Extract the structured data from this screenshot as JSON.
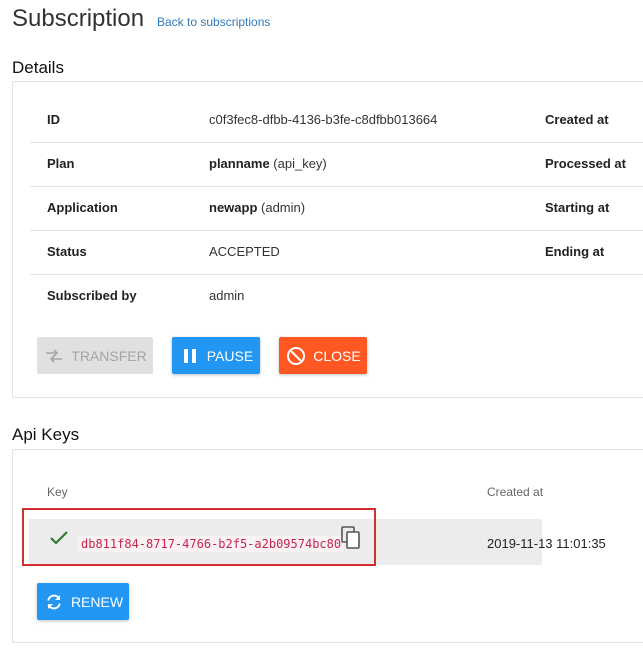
{
  "header": {
    "title": "Subscription",
    "back_link": "Back to subscriptions"
  },
  "details": {
    "title": "Details",
    "rows": [
      {
        "label": "ID",
        "value": "c0f3fec8-dfbb-4136-b3fe-c8dfbb013664",
        "right_label": "Created at"
      },
      {
        "label": "Plan",
        "value_bold": "planname",
        "value_rest": " (api_key)",
        "right_label": "Processed at"
      },
      {
        "label": "Application",
        "value_bold": "newapp",
        "value_rest": " (admin)",
        "right_label": "Starting at"
      },
      {
        "label": "Status",
        "value": "ACCEPTED",
        "right_label": "Ending at"
      },
      {
        "label": "Subscribed by",
        "value": "admin"
      }
    ],
    "actions": {
      "transfer": "TRANSFER",
      "pause": "PAUSE",
      "close": "CLOSE"
    }
  },
  "api_keys": {
    "title": "Api Keys",
    "columns": {
      "key": "Key",
      "created_at": "Created at"
    },
    "rows": [
      {
        "key": "db811f84-8717-4766-b2f5-a2b09574bc80",
        "created_at": "2019-11-13 11:01:35"
      }
    ],
    "renew": "RENEW"
  },
  "icons": {
    "transfer": "swap-horizontal-icon",
    "pause": "pause-icon",
    "close": "block-icon",
    "valid": "check-icon",
    "copy": "copy-icon",
    "renew": "refresh-icon"
  },
  "colors": {
    "primary": "#2196f3",
    "danger": "#ff5722",
    "disabled": "#e0e0e0",
    "link": "#337ab7",
    "check": "#2e7d32",
    "key_text": "#c7254e",
    "highlight_border": "#d32f2f"
  }
}
